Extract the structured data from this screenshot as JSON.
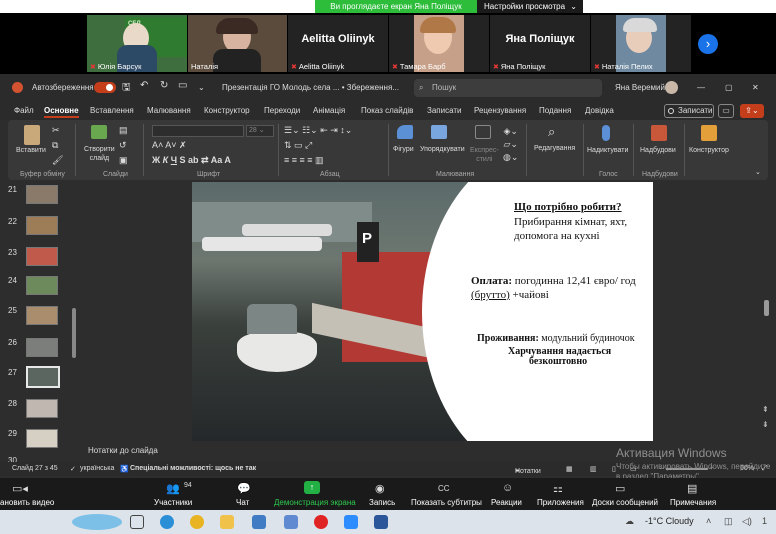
{
  "share_banner": {
    "text": "Ви проглядаєте екран Яна Поліщук",
    "options_label": "Настройки просмотра"
  },
  "participants": [
    {
      "name": "Юлія Барсук"
    },
    {
      "name": "Наталія"
    },
    {
      "name": "Aelitta Oliinyk",
      "display_name": "Aelitta Oliinyk"
    },
    {
      "name": "Тамара Барб"
    },
    {
      "name": "Яна Поліщук",
      "display_name": "Яна Поліщук"
    },
    {
      "name": "Наталія Пелих"
    }
  ],
  "ppt": {
    "autosave_label": "Автозбереження",
    "doc_title": "Презентація ГО Молодь села ... • Збереження...",
    "search_placeholder": "Пошук",
    "user_name": "Яна Веремий",
    "tabs": [
      "Файл",
      "Основне",
      "Вставлення",
      "Малювання",
      "Конструктор",
      "Переходи",
      "Анімація",
      "Показ слайдів",
      "Записати",
      "Рецензування",
      "Подання",
      "Довідка"
    ],
    "record_button": "Записати",
    "ribbon": {
      "paste": "Вставити",
      "create_slide_1": "Створити",
      "create_slide_2": "слайд",
      "shapes": "Фігури",
      "arrange": "Упорядкувати",
      "quick_styles_1": "Експрес-",
      "quick_styles_2": "стилі",
      "editing": "Редагування",
      "dictate": "Надиктувати",
      "addins": "Надбудови",
      "designer": "Конструктор",
      "groups": {
        "clipboard": "Буфер обміну",
        "slides": "Слайди",
        "font": "Шрифт",
        "paragraph": "Абзац",
        "drawing": "Малювання",
        "voice": "Голос",
        "addins": "Надбудови"
      }
    },
    "slide_numbers": [
      "21",
      "22",
      "23",
      "24",
      "25",
      "26",
      "27",
      "28",
      "29",
      "30"
    ],
    "slide": {
      "heading": "Що потрібно робити?",
      "duties_1": "Прибирання кімнат, яхт,",
      "duties_2": "допомога на кухні",
      "pay_label": "Оплата:",
      "pay_1": " погодинна 12,41 євро/ год",
      "pay_2_u": "(брутто)",
      "pay_2": " +чайові",
      "housing_label": "Проживання:",
      "housing": " модульний будиночок",
      "food_1": "Харчування надається",
      "food_2": "безкоштовно"
    },
    "notes": "Нотатки до слайда",
    "status": {
      "slide": "Слайд 27 з 45",
      "lang": "українська",
      "access": "Спеціальні можливості: щось не так",
      "notes": "Нотатки",
      "zoom": "60%"
    },
    "watermark_1": "Активация Windows",
    "watermark_2a": "Чтобы активировать Windows, перейдите",
    "watermark_2b": "в раздел \"Параметры\"."
  },
  "zoom_bar": {
    "video": "ановить видео",
    "participants": "Участники",
    "participants_count": "94",
    "chat": "Чат",
    "share": "Демонстрация экрана",
    "record": "Запись",
    "captions": "Показать субтитры",
    "reactions": "Реакции",
    "apps": "Приложения",
    "whiteboards": "Доски сообщений",
    "notes": "Примечания"
  },
  "taskbar": {
    "weather": "-1°C Cloudy"
  }
}
